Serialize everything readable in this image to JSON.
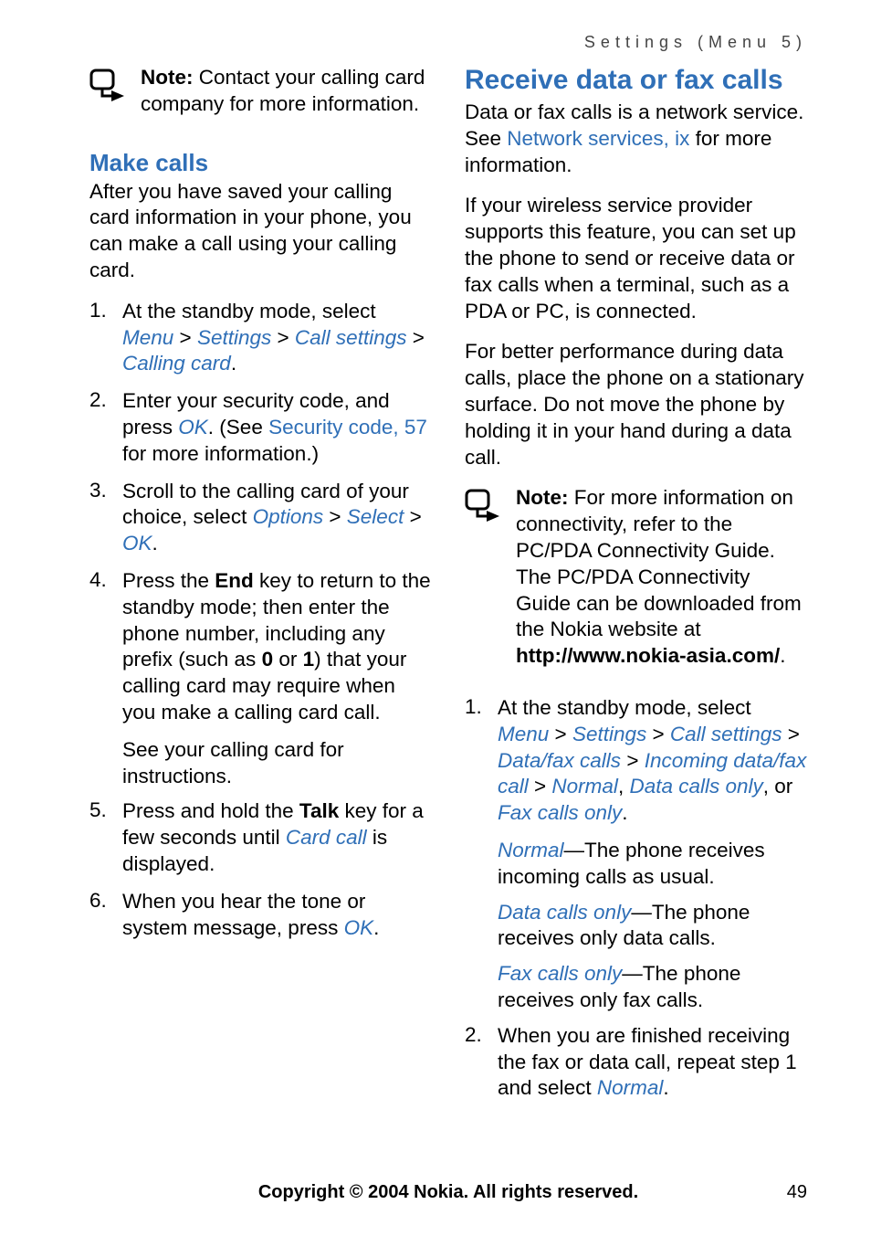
{
  "running_head": "Settings (Menu 5)",
  "footer": {
    "copyright": "Copyright © 2004 Nokia. All rights reserved.",
    "page_number": "49"
  },
  "left": {
    "note_label": "Note:",
    "note_text": " Contact your calling card company for more information.",
    "make_calls_heading": "Make calls",
    "make_calls_intro": "After you have saved your calling card information in your phone, you can make a call using your calling card.",
    "steps": {
      "s1": {
        "num": "1.",
        "pre": "At the standby mode, select ",
        "menu": "Menu",
        "gt1": " > ",
        "settings": "Settings",
        "gt2": " > ",
        "call_settings": "Call settings",
        "gt3": " > ",
        "calling_card": "Calling card",
        "period": "."
      },
      "s2": {
        "num": "2.",
        "pre": "Enter your security code, and press ",
        "ok": "OK",
        "dot_see": ". (See ",
        "link": "Security code, 57",
        "tail": " for more information.)"
      },
      "s3": {
        "num": "3.",
        "pre": "Scroll to the calling card of your choice, select ",
        "options": "Options",
        "gt1": " > ",
        "select": "Select",
        "gt2": " > ",
        "ok": "OK",
        "period": "."
      },
      "s4": {
        "num": "4.",
        "pre": "Press the ",
        "end": "End",
        "mid": " key to return to the standby mode; then enter the phone number, including any prefix (such as ",
        "zero": "0",
        "or": " or ",
        "one": "1",
        "tail": ") that your calling card may require when you make a calling card call."
      },
      "s4_sub": "See your calling card for instructions.",
      "s5": {
        "num": "5.",
        "pre": "Press and hold the ",
        "talk": "Talk",
        "mid": " key for a few seconds until ",
        "card_call": "Card call",
        "tail": " is displayed."
      },
      "s6": {
        "num": "6.",
        "pre": "When you hear the tone or system message, press ",
        "ok": "OK",
        "period": "."
      }
    }
  },
  "right": {
    "heading": "Receive data or fax calls",
    "p1_pre": "Data or fax calls is a network service. See ",
    "p1_link": "Network services, ix",
    "p1_tail": " for more information.",
    "p2": "If your wireless service provider supports this feature, you can set up the phone to send or receive data or fax calls when a terminal, such as a PDA or PC, is connected.",
    "p3": "For better performance during data calls, place the phone on a stationary surface. Do not move the phone by holding it in your hand during a data call.",
    "note_label": "Note:",
    "note_text_1": " For more information on connectivity, refer to the PC/PDA Connectivity Guide. The PC/PDA Connectivity Guide can be downloaded from the Nokia website at ",
    "note_url": "http://www.nokia-asia.com/",
    "note_period": ".",
    "steps": {
      "s1": {
        "num": "1.",
        "pre": "At the standby mode, select ",
        "menu": "Menu",
        "gt1": " > ",
        "settings": "Settings",
        "gt2": " > ",
        "call_settings": "Call settings",
        "gt3": " > ",
        "data_fax": "Data/fax calls",
        "gt4": " > ",
        "incoming": "Incoming data/fax call",
        "gt5": " > ",
        "normal": "Normal",
        "comma1": ", ",
        "dco": "Data calls only",
        "comma2": ", or ",
        "fco": "Fax calls only",
        "period": "."
      },
      "s1_opts": {
        "normal_t": "Normal",
        "normal_d": "—The phone receives incoming calls as usual.",
        "dco_t": "Data calls only",
        "dco_d": "—The phone receives only data calls.",
        "fco_t": "Fax calls only",
        "fco_d": "—The phone receives only fax calls."
      },
      "s2": {
        "num": "2.",
        "pre": "When you are finished receiving the fax or data call, repeat step 1 and select ",
        "normal": "Normal",
        "period": "."
      }
    }
  }
}
